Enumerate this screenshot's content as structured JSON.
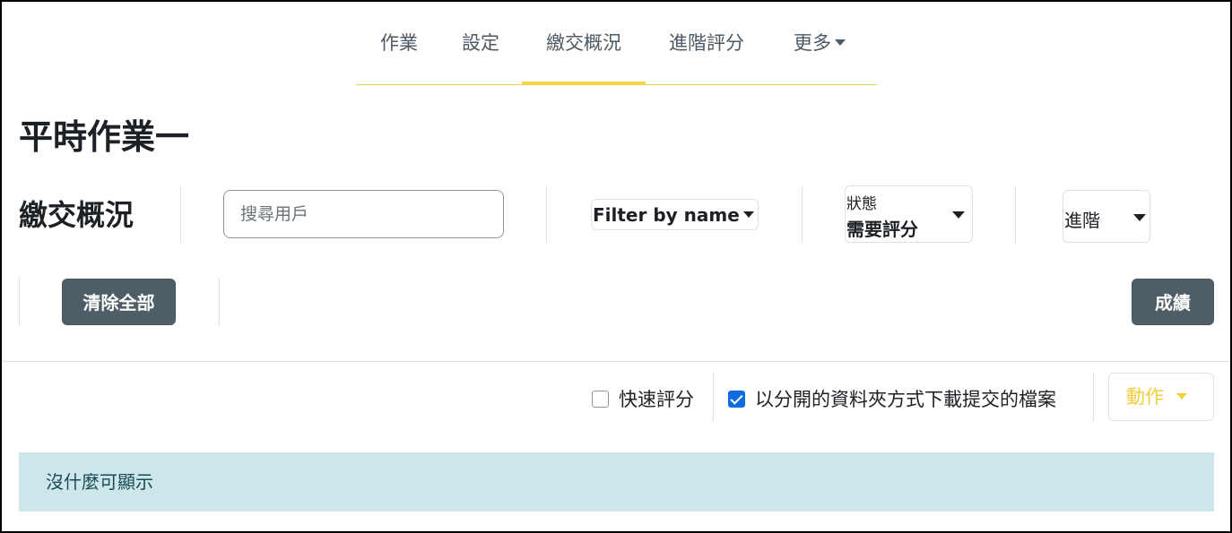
{
  "tabs": [
    {
      "label": "作業"
    },
    {
      "label": "設定"
    },
    {
      "label": "繳交概況",
      "active": true
    },
    {
      "label": "進階評分"
    },
    {
      "label": "更多"
    }
  ],
  "page_title": "平時作業一",
  "section_title": "繳交概況",
  "search": {
    "placeholder": "搜尋用戶",
    "value": ""
  },
  "filter_by_name": {
    "label": "Filter by name"
  },
  "status_filter": {
    "label": "狀態",
    "value": "需要評分"
  },
  "advanced_filter": {
    "label": "進階"
  },
  "clear_all_button": "清除全部",
  "grades_button": "成績",
  "quick_grading": {
    "label": "快速評分",
    "checked": false
  },
  "download_separate_folders": {
    "label": "以分開的資料夾方式下載提交的檔案",
    "checked": true
  },
  "actions_button": "動作",
  "empty_message": "沒什麼可顯示",
  "colors": {
    "accent_yellow": "#f5d64a",
    "dark_button": "#4f5e66",
    "alert_bg": "#cce6ea",
    "checkbox_blue": "#0f6cde"
  },
  "icons": [
    "chevron-down-icon",
    "checkbox-icon"
  ]
}
